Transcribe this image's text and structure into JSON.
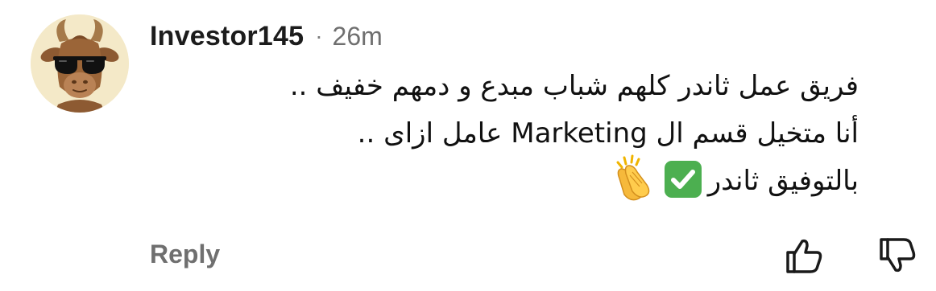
{
  "comment": {
    "author": "Investor145",
    "separator": "·",
    "timestamp": "26m",
    "lines": [
      "فريق عمل ثاندر كلهم شباب مبدع و دمهم خفيف ..",
      "أنا متخيل قسم ال Marketing عامل ازاى ..",
      "بالتوفيق ثاندر"
    ],
    "line3_emojis": [
      "check-mark-button-emoji",
      "clapping-hands-emoji"
    ],
    "avatar_icon": "goat-with-sunglasses-avatar"
  },
  "actions": {
    "reply_label": "Reply",
    "upvote_icon": "thumbs-up-icon",
    "downvote_icon": "thumbs-down-icon"
  },
  "colors": {
    "text": "#111111",
    "muted": "#6f6f6f",
    "check_green": "#4caf50",
    "avatar_bg": "#f4e9c8"
  }
}
